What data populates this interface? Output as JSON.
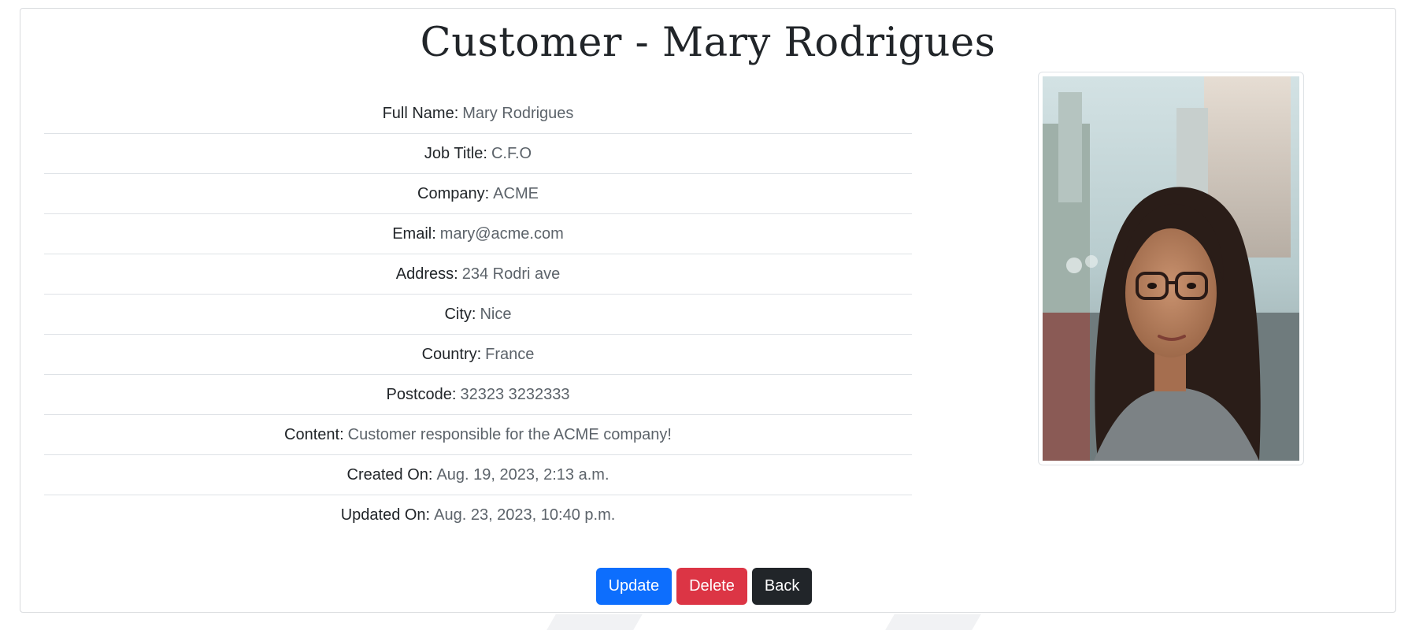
{
  "page": {
    "title": "Customer - Mary Rodrigues"
  },
  "details": [
    {
      "label": "Full Name:",
      "value": "Mary Rodrigues"
    },
    {
      "label": "Job Title:",
      "value": "C.F.O"
    },
    {
      "label": "Company:",
      "value": "ACME"
    },
    {
      "label": "Email:",
      "value": "mary@acme.com"
    },
    {
      "label": "Address:",
      "value": "234 Rodri ave"
    },
    {
      "label": "City:",
      "value": "Nice"
    },
    {
      "label": "Country:",
      "value": "France"
    },
    {
      "label": "Postcode:",
      "value": "32323 3232333"
    },
    {
      "label": "Content:",
      "value": "Customer responsible for the ACME company!"
    },
    {
      "label": "Created On:",
      "value": "Aug. 19, 2023, 2:13 a.m."
    },
    {
      "label": "Updated On:",
      "value": "Aug. 23, 2023, 10:40 p.m."
    }
  ],
  "actions": {
    "update_label": "Update",
    "delete_label": "Delete",
    "back_label": "Back"
  },
  "colors": {
    "primary": "#0d6efd",
    "danger": "#dc3545",
    "dark": "#212529"
  }
}
